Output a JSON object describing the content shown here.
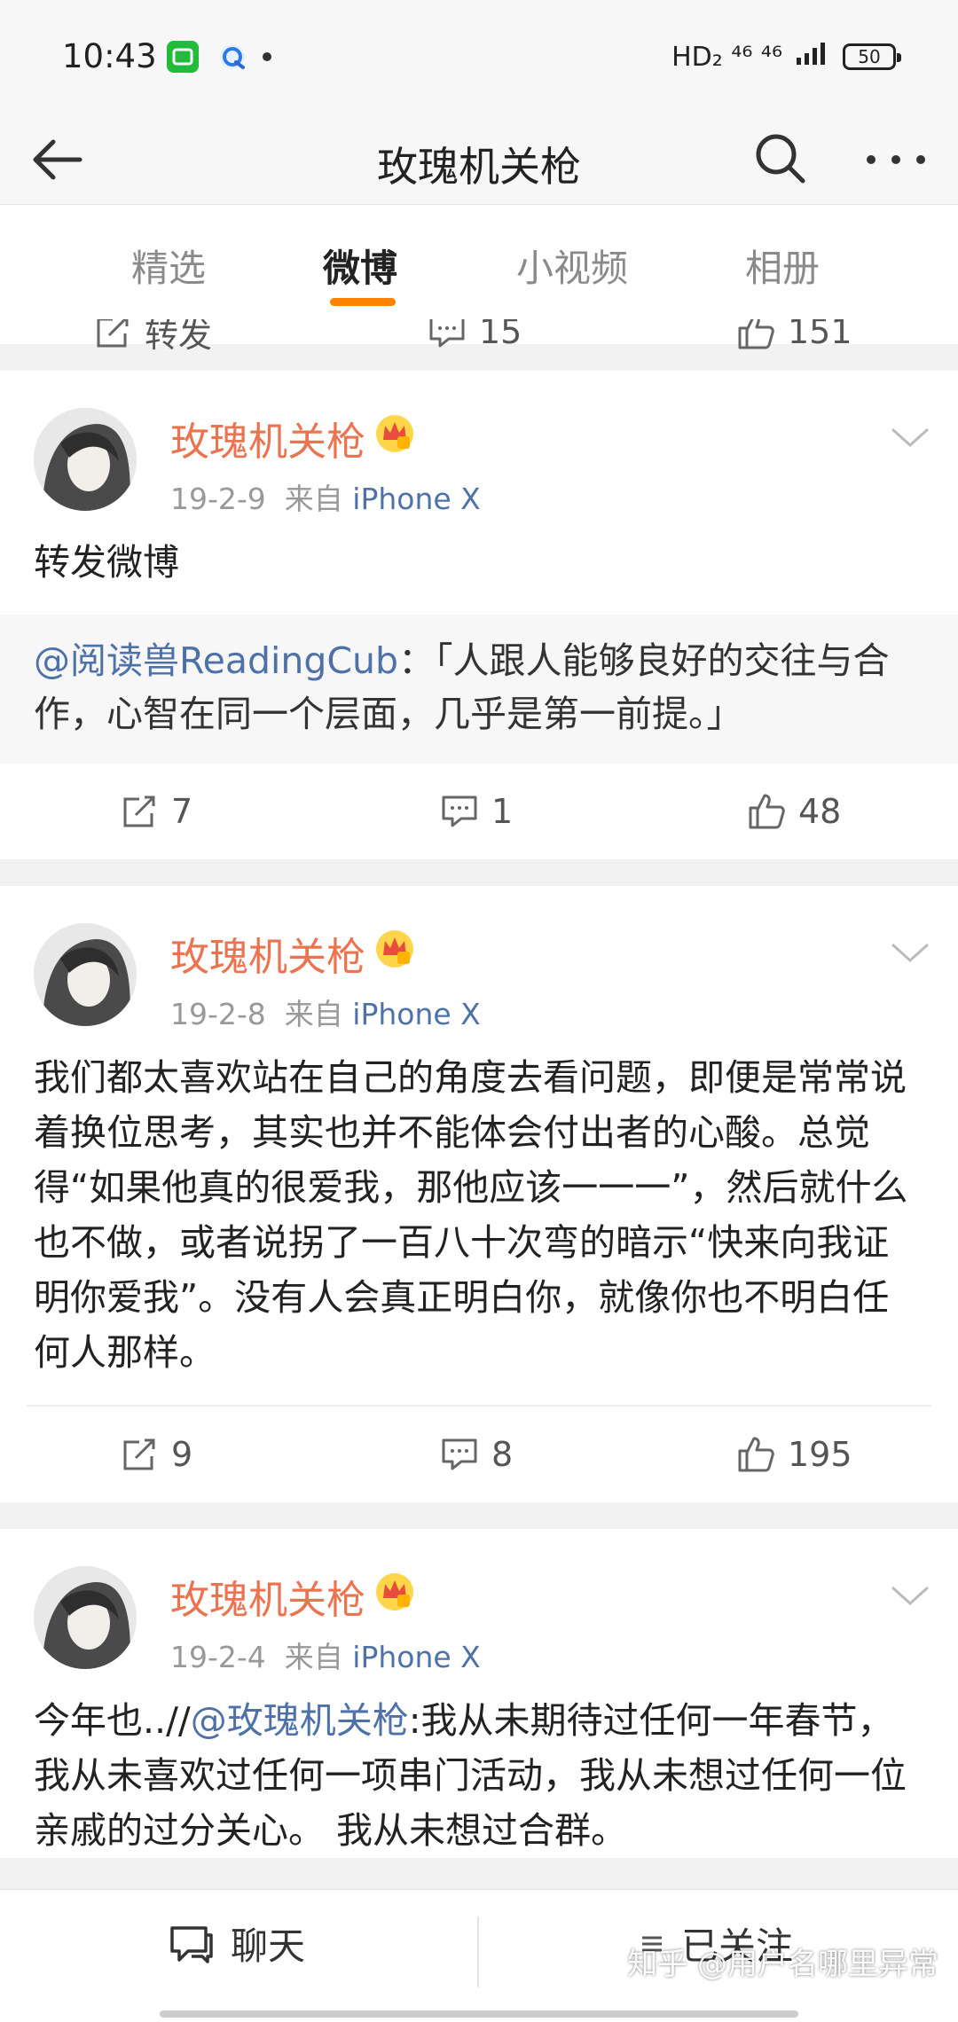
{
  "status_bar": {
    "time": "10:43",
    "iqiyi_label": "iQIYI",
    "network": "HD₂  ⁴⁶  ⁴⁶",
    "battery": "50"
  },
  "nav": {
    "title": "玫瑰机关枪"
  },
  "tabs": [
    {
      "label": "精选"
    },
    {
      "label": "微博"
    },
    {
      "label": "小视频"
    },
    {
      "label": "相册"
    }
  ],
  "top_actions": {
    "repost_label": "转发",
    "comments": "15",
    "likes": "151"
  },
  "posts": [
    {
      "author": "玫瑰机关枪",
      "date": "19-2-9",
      "from": "来自",
      "source": "iPhone X",
      "text": "转发微博",
      "repost_user": "@阅读兽ReadingCub",
      "repost_text": "：「人跟人能够良好的交往与合作，心智在同一个层面，几乎是第一前提。」",
      "reposts": "7",
      "comments": "1",
      "likes": "48"
    },
    {
      "author": "玫瑰机关枪",
      "date": "19-2-8",
      "from": "来自",
      "source": "iPhone X",
      "text": "我们都太喜欢站在自己的角度去看问题，即便是常常说着换位思考，其实也并不能体会付出者的心酸。总觉得“如果他真的很爱我，那他应该一一一”，然后就什么也不做，或者说拐了一百八十次弯的暗示“快来向我证明你爱我”。没有人会真正明白你，就像你也不明白任何人那样。",
      "reposts": "9",
      "comments": "8",
      "likes": "195"
    },
    {
      "author": "玫瑰机关枪",
      "date": "19-2-4",
      "from": "来自",
      "source": "iPhone X",
      "text_prefix": "今年也..//",
      "text_mention": "@玫瑰机关枪",
      "text_rest": ":我从未期待过任何一年春节，我从未喜欢过任何一项串门活动，我从未想过任何一位亲戚的过分关心。 我从未想过合群。"
    }
  ],
  "bottom_bar": {
    "chat_label": "聊天",
    "follow_label": "已关注",
    "watermark": "知乎 @用户名哪里异常"
  },
  "colors": {
    "accent": "#ff8200",
    "author": "#eb7350",
    "link": "#4e72a8"
  }
}
